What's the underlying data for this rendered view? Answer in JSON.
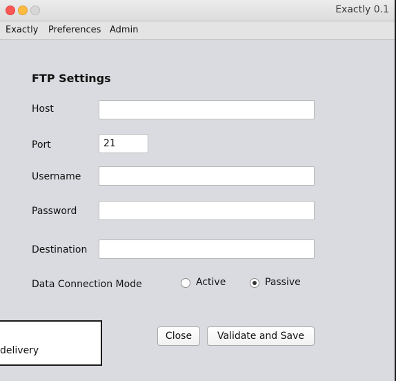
{
  "window": {
    "title": "Exactly 0.1"
  },
  "menubar": {
    "items": [
      "Exactly",
      "Preferences",
      "Admin"
    ]
  },
  "form": {
    "heading": "FTP Settings",
    "host": {
      "label": "Host",
      "value": ""
    },
    "port": {
      "label": "Port",
      "value": "21"
    },
    "username": {
      "label": "Username",
      "value": ""
    },
    "password": {
      "label": "Password",
      "value": ""
    },
    "destination": {
      "label": "Destination",
      "value": ""
    },
    "mode": {
      "label": "Data Connection Mode",
      "options": [
        "Active",
        "Passive"
      ],
      "selected": "Passive"
    }
  },
  "buttons": {
    "close": "Close",
    "validate_save": "Validate and Save"
  },
  "overlay": {
    "text": "delivery"
  },
  "colors": {
    "window_bg": "#d9dbe0",
    "close_light": "#fc5753",
    "minimize_light": "#fdbc40"
  }
}
